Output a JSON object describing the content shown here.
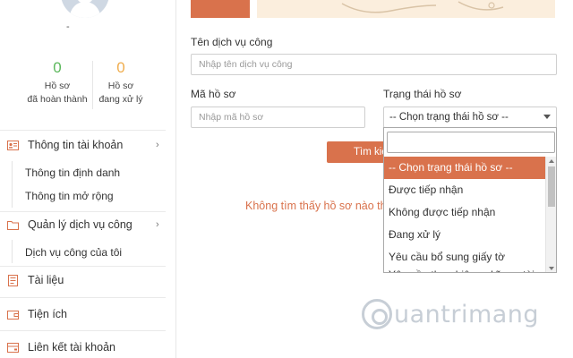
{
  "sidebar": {
    "stats": {
      "completed": {
        "count": "0",
        "label_line1": "Hồ sơ",
        "label_line2": "đã hoàn thành"
      },
      "processing": {
        "count": "0",
        "label_line1": "Hồ sơ",
        "label_line2": "đang xử lý"
      }
    },
    "menu": {
      "account": {
        "label": "Thông tin tài khoản",
        "icon": "id-card-icon"
      },
      "account_items": [
        "Thông tin định danh",
        "Thông tin mở rộng"
      ],
      "services": {
        "label": "Quản lý dịch vụ công",
        "icon": "folder-icon"
      },
      "services_items": [
        "Dịch vụ công của tôi"
      ],
      "documents": {
        "label": "Tài liệu",
        "icon": "document-icon"
      },
      "utilities": {
        "label": "Tiện ích",
        "icon": "wallet-icon"
      },
      "linked": {
        "label": "Liên kết tài khoản",
        "icon": "link-icon"
      }
    }
  },
  "form": {
    "service_name": {
      "label": "Tên dịch vụ công",
      "placeholder": "Nhập tên dịch vụ công"
    },
    "record_code": {
      "label": "Mã hồ sơ",
      "placeholder": "Nhập mã hồ sơ"
    },
    "status": {
      "label": "Trạng thái hồ sơ",
      "selected": "-- Chọn trạng thái hồ sơ --",
      "options": [
        "-- Chọn trạng thái hồ sơ --",
        "Được tiếp nhận",
        "Không được tiếp nhận",
        "Đang xử lý",
        "Yêu cầu bổ sung giấy tờ",
        "Yêu cầu thực hiện nghĩa vụ tài"
      ]
    },
    "search_button": "Tìm kiếm"
  },
  "results": {
    "empty_message": "Không tìm thấy hồ sơ nào thoả mãn"
  },
  "watermark": {
    "text": "uantrimang"
  },
  "colors": {
    "accent": "#d9724c",
    "completed": "#5cb85c",
    "processing": "#f0ad4e",
    "banner": "#fbeedd"
  }
}
